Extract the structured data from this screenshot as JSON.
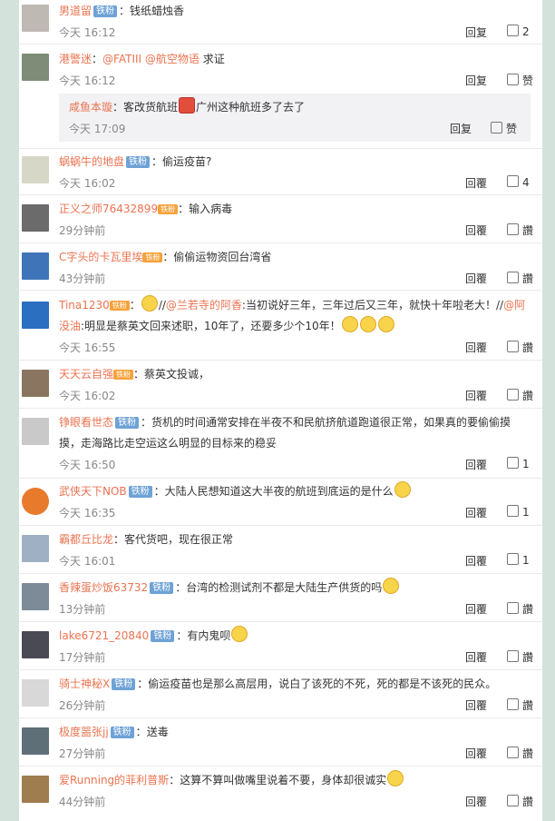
{
  "comments": [
    {
      "user": "男道留",
      "badge": "铁粉",
      "text": "钱纸蜡烛香",
      "time": "今天 16:12",
      "reply": "回复",
      "likes": "2",
      "avatar_color": "#bfb9b3"
    },
    {
      "user": "港警迷",
      "text_mention1": "@FATIII",
      "text_mention2": "@航空物语",
      "text": "求证",
      "time": "今天 16:12",
      "reply": "回复",
      "likes": "赞",
      "avatar_color": "#7f8c78",
      "sub": {
        "user": "咸鱼本璇",
        "text1": "客改货航班",
        "text2": "广州这种航班多了去了",
        "time": "今天 17:09",
        "reply": "回复",
        "likes": "赞"
      }
    },
    {
      "user": "蜗蜗牛的地盘",
      "badge": "铁粉",
      "text": "偷运疫苗?",
      "time": "今天 16:02",
      "reply": "回覆",
      "likes": "4",
      "avatar_color": "#d7d7c7"
    },
    {
      "user": "正义之师76432899",
      "badge_small": "铁粉",
      "text": "输入病毒",
      "time": "29分钟前",
      "reply": "回覆",
      "likes": "讚",
      "avatar_color": "#6b6b6b"
    },
    {
      "user": "C字头的卡瓦里埃",
      "badge_small": "铁粉",
      "text": "偷偷运物资回台湾省",
      "time": "43分钟前",
      "reply": "回覆",
      "likes": "讚",
      "avatar_color": "#3f74b8"
    },
    {
      "user": "Tina1230",
      "badge_small": "铁粉",
      "text_a": "//",
      "mention_a": "@兰若寺的阿香",
      "text_b": ":当初说好三年，三年过后又三年，就快十年啦老大！//",
      "mention_b": "@阿",
      "line2_mention": "没油",
      "line2_text": ":明显是蔡英文回来述职，10年了，还要多少个10年！",
      "time": "今天 16:55",
      "reply": "回覆",
      "likes": "讚",
      "avatar_color": "#2a6fc0"
    },
    {
      "user": "天天云自强",
      "badge_small": "铁粉",
      "text": "蔡英文投诚，",
      "time": "今天 16:02",
      "reply": "回覆",
      "likes": "讚",
      "avatar_color": "#8a7660"
    },
    {
      "user": "铮眼看世态",
      "badge": "铁粉",
      "text": "货机的时间通常安排在半夜不和民航挤航道跑道很正常，如果真的要偷偷摸",
      "text2": "摸，走海路比走空运这么明显的目标来的稳妥",
      "time": "今天 16:50",
      "reply": "回覆",
      "likes": "1",
      "avatar_color": "#c9c9c9"
    },
    {
      "user": "武侠天下NOB",
      "badge": "铁粉",
      "text": "大陆人民想知道这大半夜的航班到底运的是什么",
      "time": "今天 16:35",
      "reply": "回覆",
      "likes": "1",
      "avatar_color": "#e87a2c"
    },
    {
      "user": "霸都丘比龙",
      "text": "客代货吧，现在很正常",
      "time": "今天 16:01",
      "reply": "回覆",
      "likes": "1",
      "avatar_color": "#9fb0c4"
    },
    {
      "user": "香辣蛋炒饭63732",
      "badge": "铁粉",
      "text": "台湾的检测试剂不都是大陆生产供货的吗",
      "time": "13分钟前",
      "reply": "回覆",
      "likes": "讚",
      "avatar_color": "#7d8a98"
    },
    {
      "user": "lake6721_20840",
      "badge": "铁粉",
      "text": "有内鬼呗",
      "time": "17分钟前",
      "reply": "回覆",
      "likes": "讚",
      "avatar_color": "#4a4a55"
    },
    {
      "user": "骑士神秘X",
      "badge": "铁粉",
      "text": "偷运疫苗也是那么高层用，说白了该死的不死，死的都是不该死的民众。",
      "time": "26分钟前",
      "reply": "回覆",
      "likes": "讚",
      "avatar_color": "#d8d8d8"
    },
    {
      "user": "极度噐张jj",
      "badge": "铁粉",
      "text": "送毒",
      "time": "27分钟前",
      "reply": "回覆",
      "likes": "讚",
      "avatar_color": "#5f6f78"
    },
    {
      "user": "爱Running的菲利普斯",
      "text": "这算不算叫做嘴里说着不要，身体却很诚实",
      "time": "44分钟前",
      "reply": "回覆",
      "likes": "讚",
      "avatar_color": "#a07d4e"
    }
  ]
}
